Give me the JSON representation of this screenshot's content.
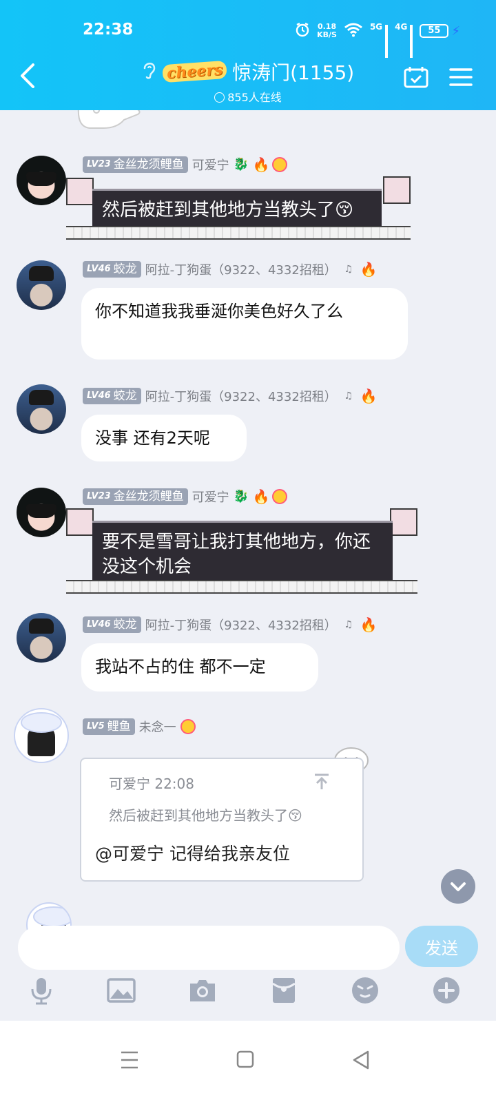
{
  "status_bar": {
    "time": "22:38",
    "net_speed": "0.18",
    "net_unit": "KB/S",
    "sig1": "5G",
    "sig2": "4G",
    "battery": "55"
  },
  "header": {
    "logo": "cheers",
    "group_name": "惊涛门(1155)",
    "online_count": "855人在线"
  },
  "messages": [
    {
      "level": "23",
      "title": "金丝龙须鲤鱼",
      "sender": "可爱宁",
      "text": "然后被赶到其他地方当教头了😚"
    },
    {
      "level": "46",
      "title": "蛟龙",
      "sender": "阿拉-丁狗蛋（9322、4332招租）",
      "text": "你不知道我我垂涎你美色好久了么"
    },
    {
      "level": "46",
      "title": "蛟龙",
      "sender": "阿拉-丁狗蛋（9322、4332招租）",
      "text": "没事 还有2天呢"
    },
    {
      "level": "23",
      "title": "金丝龙须鲤鱼",
      "sender": "可爱宁",
      "text": "要不是雪哥让我打其他地方，你还没这个机会"
    },
    {
      "level": "46",
      "title": "蛟龙",
      "sender": "阿拉-丁狗蛋（9322、4332招租）",
      "text": "我站不占的住 都不一定"
    },
    {
      "level": "5",
      "title": "鲤鱼",
      "sender": "未念一",
      "quote_header": "可爱宁 22:08",
      "quote_text": "然后被赶到其他地方当教头了😚",
      "text": "@可爱宁 记得给我亲友位"
    }
  ],
  "lv_prefix": "LV",
  "input": {
    "placeholder": "",
    "send_label": "发送"
  },
  "colors": {
    "header": "#1fb6f6",
    "send_button": "#a8dcf7",
    "level_badge": "#9aa3b4"
  },
  "icons": [
    "back-arrow-icon",
    "ear-icon",
    "calendar-check-icon",
    "menu-icon",
    "voice-icon",
    "image-icon",
    "camera-icon",
    "red-packet-icon",
    "emoji-icon",
    "plus-icon",
    "scroll-down-icon"
  ]
}
